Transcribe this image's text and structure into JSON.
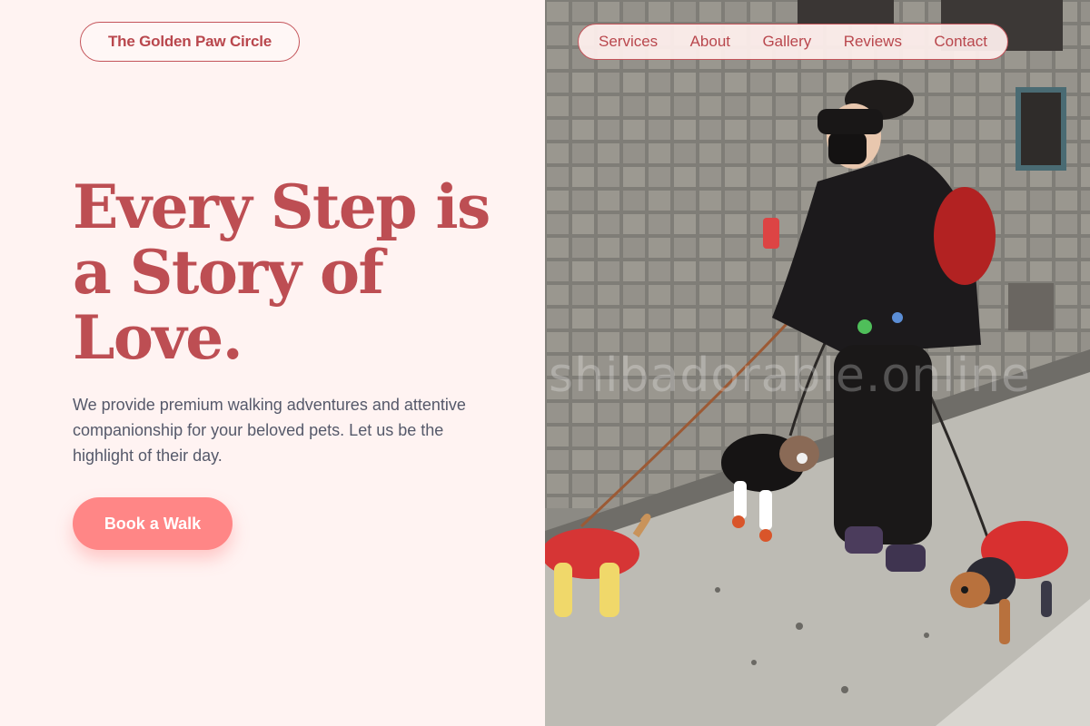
{
  "brand": {
    "name": "The Golden Paw Circle"
  },
  "nav": {
    "items": [
      {
        "label": "Services"
      },
      {
        "label": "About"
      },
      {
        "label": "Gallery"
      },
      {
        "label": "Reviews"
      },
      {
        "label": "Contact"
      }
    ]
  },
  "hero": {
    "headline": "Every Step is a Story of Love.",
    "description": "We provide premium walking adventures and attentive companionship for your beloved pets. Let us be the highlight of their day.",
    "cta_label": "Book a Walk",
    "photo_alt": "Dog walker on a city sidewalk with several dogs in jackets",
    "watermark": "shibadorable.online"
  },
  "colors": {
    "background": "#fff3f2",
    "accent": "#bd4e53",
    "cta": "#ff8686",
    "body_text": "#55596a"
  }
}
